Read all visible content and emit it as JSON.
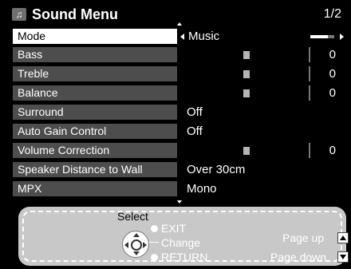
{
  "header": {
    "title": "Sound Menu",
    "page": "1/2",
    "icon": "music-note-icon"
  },
  "menu": {
    "mode": {
      "label": "Mode",
      "value": "Music"
    },
    "bass": {
      "label": "Bass",
      "value": "0",
      "level": 0
    },
    "treble": {
      "label": "Treble",
      "value": "0",
      "level": 0
    },
    "balance": {
      "label": "Balance",
      "value": "0",
      "level": 0
    },
    "surround": {
      "label": "Surround",
      "value": "Off"
    },
    "auto_gain": {
      "label": "Auto Gain Control",
      "value": "Off"
    },
    "volume_correction": {
      "label": "Volume Correction",
      "value": "0",
      "level": 0
    },
    "speaker_distance": {
      "label": "Speaker Distance to Wall",
      "value": "Over 30cm"
    },
    "mpx": {
      "label": "MPX",
      "value": "Mono"
    }
  },
  "guide": {
    "select": "Select",
    "exit": "EXIT",
    "change": "Change",
    "return": "RETURN",
    "page_up": "Page up",
    "page_down": "Page down"
  },
  "colors": {
    "label_bg": "#4d4d4d",
    "selected_bg": "#ffffff",
    "guide_bg": "#c8c8c8"
  }
}
